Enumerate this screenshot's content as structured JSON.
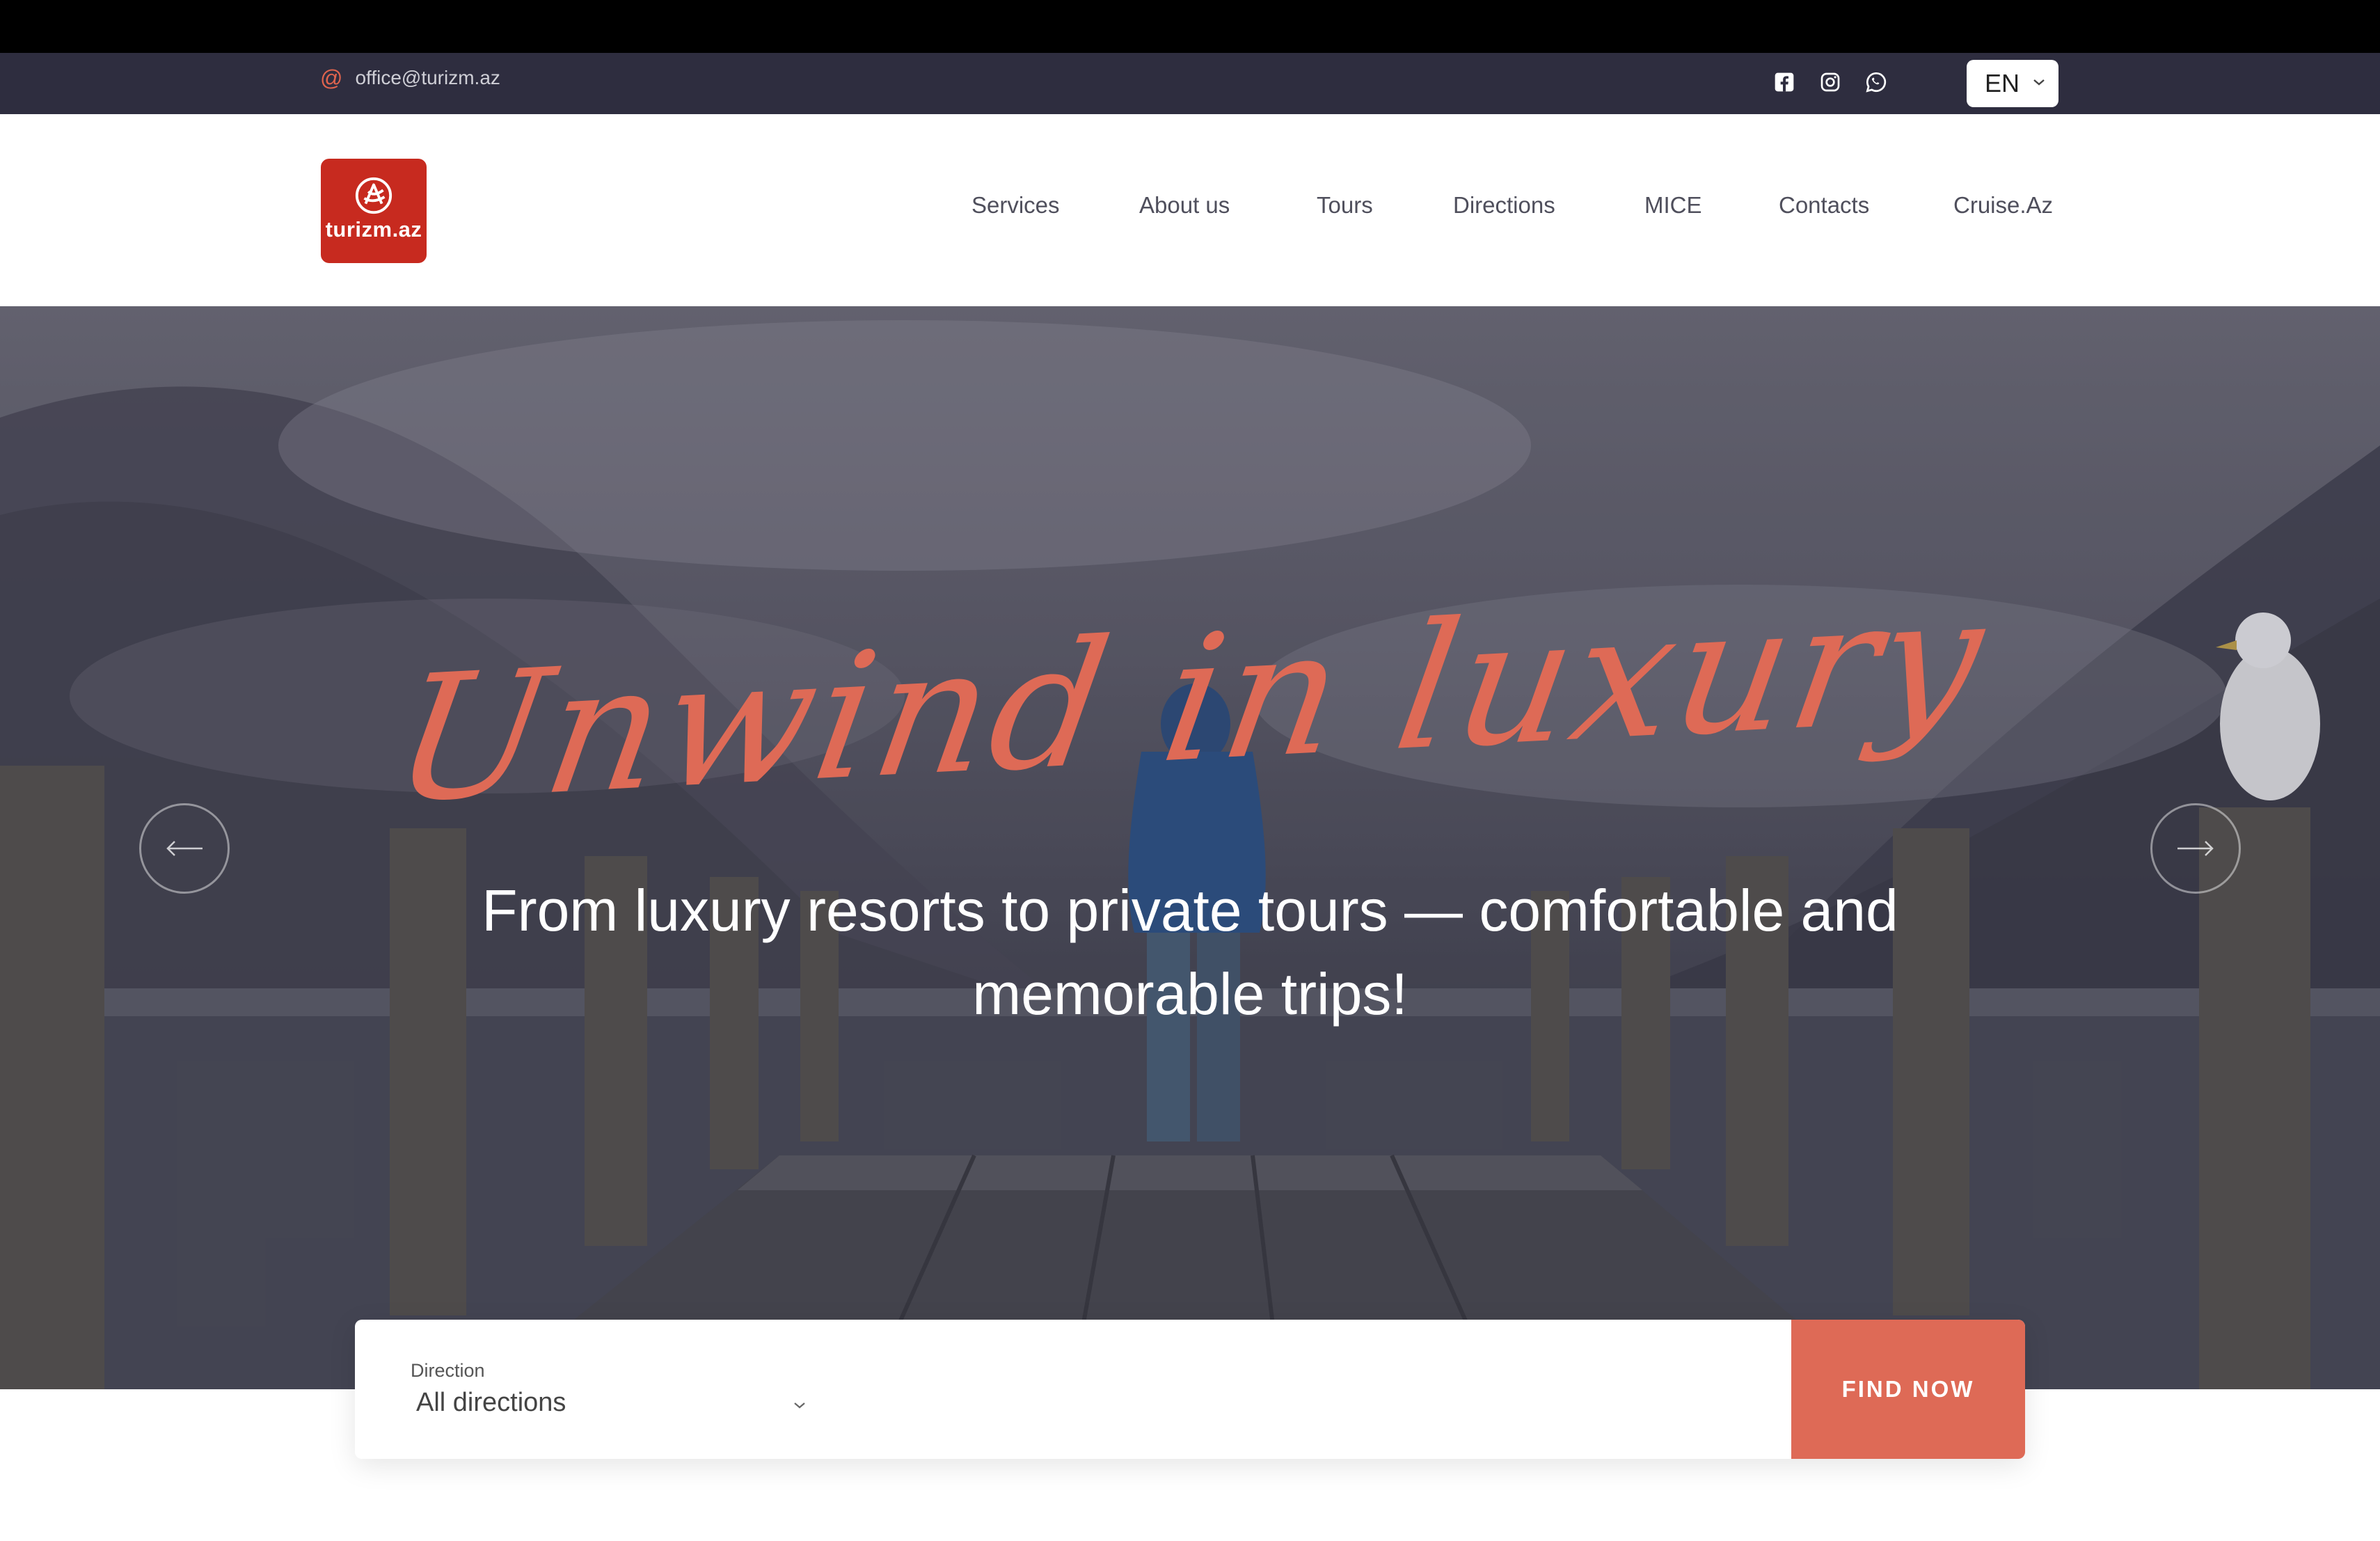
{
  "topbar": {
    "email": "office@turizm.az",
    "socials": [
      "facebook-icon",
      "instagram-icon",
      "whatsapp-icon"
    ],
    "language": "EN"
  },
  "header": {
    "logo_text": "turizm.az",
    "nav": [
      "Services",
      "About us",
      "Tours",
      "Directions",
      "MICE",
      "Contacts",
      "Cruise.Az"
    ]
  },
  "hero": {
    "script_title": "Unwind in luxury",
    "subtitle": "From luxury resorts to private tours — comfortable and memorable trips!"
  },
  "search": {
    "direction_label": "Direction",
    "direction_value": "All directions",
    "button_label": "FIND NOW"
  },
  "colors": {
    "accent": "#de6a56",
    "topbar_bg": "#2e2d3f",
    "logo_bg": "#c72a1f"
  }
}
